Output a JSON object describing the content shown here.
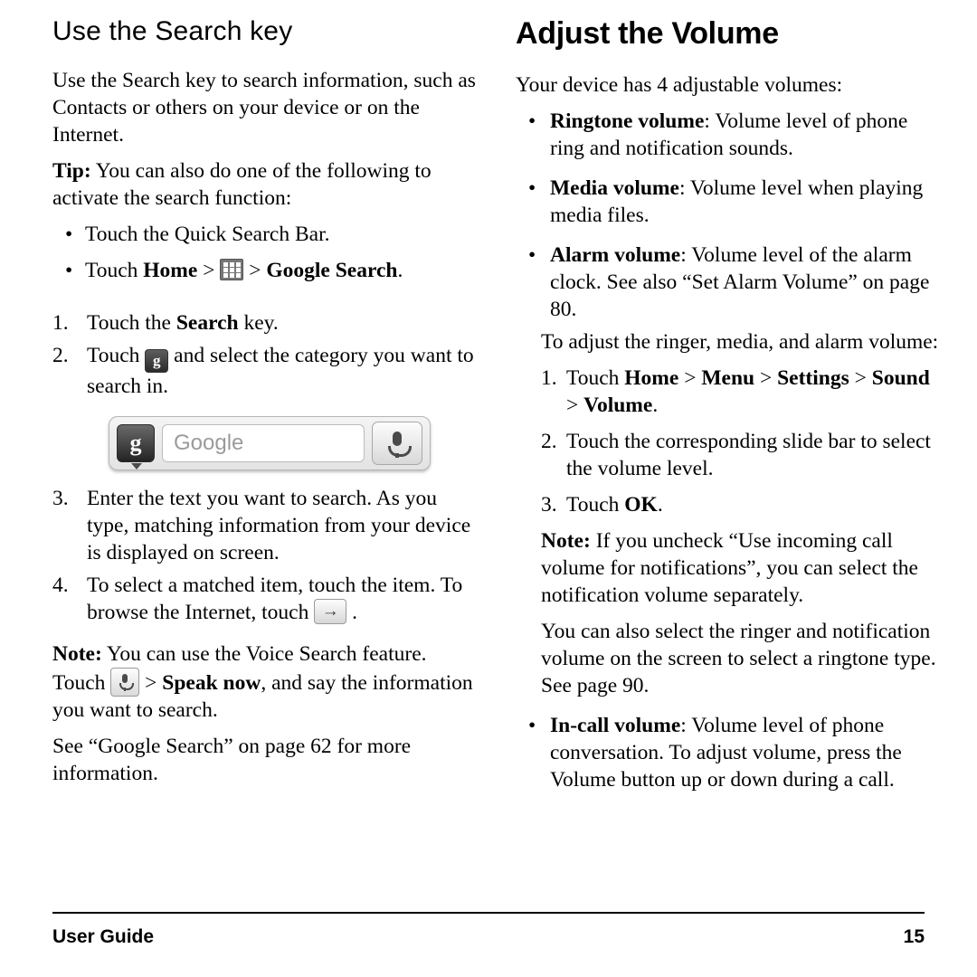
{
  "document": {
    "footer": {
      "left_label": "User Guide",
      "page_number": "15"
    }
  },
  "left_column": {
    "title": "Use the Search key",
    "intro": "Use the Search key to search information, such as Contacts or others on your device or on the Internet.",
    "tip_label": "Tip:",
    "tip_text": " You can also do one of the following to activate the search function:",
    "bullets": [
      {
        "dot": "•",
        "text": "Touch the Quick Search Bar."
      },
      {
        "dot": "•",
        "prefix": "Touch ",
        "bold1": "Home",
        "sep1": " > ",
        "icon": "apps-grid-icon",
        "sep2": " > ",
        "bold2": "Google Search",
        "suffix": "."
      }
    ],
    "steps": [
      {
        "n": "1.",
        "prefix": "Touch the ",
        "bold": "Search",
        "suffix": " key."
      },
      {
        "n": "2.",
        "prefix": "Touch ",
        "icon": "google-g-icon",
        "suffix": " and select the category you want to search in."
      },
      {
        "n": "3.",
        "text": "Enter the text you want to search. As you type, matching information from your device is displayed on screen."
      },
      {
        "n": "4.",
        "prefix": "To select a matched item, touch the item. To browse the Internet, touch ",
        "icon": "go-arrow-icon",
        "suffix": " ."
      }
    ],
    "figure": {
      "name": "quick-search-bar-figure",
      "google_button_label": "g",
      "input_placeholder": "Google",
      "mic_button_name": "voice-search-icon"
    },
    "note_label": "Note:",
    "note_text_1": " You can use the Voice Search feature. Touch ",
    "note_icon": "microphone-icon",
    "note_text_2": " > ",
    "note_bold": "Speak now",
    "note_text_3": ", and say the information you want to search.",
    "see_also": "See “Google Search” on page 62 for more information."
  },
  "right_column": {
    "title": "Adjust the Volume",
    "intro": "Your device has 4 adjustable volumes:",
    "bullets": [
      {
        "dot": "•",
        "bold": "Ringtone volume",
        "text": ": Volume level of phone ring and notification sounds."
      },
      {
        "dot": "•",
        "bold": "Media volume",
        "text": ": Volume level when playing media files."
      },
      {
        "dot": "•",
        "bold": "Alarm volume",
        "text": ": Volume level of the alarm clock. See also “Set Alarm Volume” on page 80."
      }
    ],
    "sub_intro": "To adjust the ringer, media, and alarm volume:",
    "steps": [
      {
        "n": "1.",
        "prefix": "Touch ",
        "b1": "Home",
        "s1": " > ",
        "b2": "Menu",
        "s2": " > ",
        "b3": "Settings",
        "s3": " > ",
        "b4": "Sound",
        "s4": " > ",
        "b5": "Volume",
        "suffix": "."
      },
      {
        "n": "2.",
        "text": "Touch the corresponding slide bar to select the volume level."
      },
      {
        "n": "3.",
        "prefix": "Touch ",
        "bold": "OK",
        "suffix": "."
      }
    ],
    "note_label": "Note:",
    "note_text": " If you uncheck “Use incoming call volume for notifications”, you can select the notification volume separately.",
    "extra_text": "You can also select the ringer and notification volume on the screen to select a ringtone type. See page 90.",
    "last_bullet": {
      "dot": "•",
      "bold": "In-call volume",
      "text": ": Volume level of phone conversation. To adjust volume, press the Volume button up or down during a call."
    }
  }
}
